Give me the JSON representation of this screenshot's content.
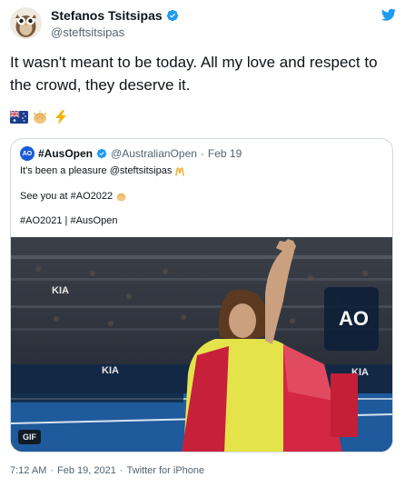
{
  "author": {
    "display_name": "Stefanos Tsitsipas",
    "handle": "@steftsitsipas",
    "verified_icon": "verified-badge-icon"
  },
  "tweet": {
    "text": "It wasn't meant to be today. All my love and respect to the crowd, they deserve it.",
    "emojis": [
      "australia-flag",
      "clapping-hands",
      "lightning"
    ]
  },
  "quote": {
    "display_name": "#AusOpen",
    "handle": "@AustralianOpen",
    "separator": "·",
    "date": "Feb 19",
    "avatar_text": "AO",
    "line1": "It's been a pleasure @steftsitsipas",
    "line2": "See you at #AO2022",
    "line3": "#AO2021 | #AusOpen",
    "media_badge": "GIF",
    "media_overlay_logo": "AO"
  },
  "footer": {
    "time": "7:12 AM",
    "separator1": "·",
    "date": "Feb 19, 2021",
    "separator2": "·",
    "source": "Twitter for iPhone"
  },
  "colors": {
    "verified": "#1d9bf0",
    "text_primary": "#0f1419",
    "text_secondary": "#536471",
    "border": "#cfd9de",
    "ao_blue": "#1a5bd9"
  }
}
